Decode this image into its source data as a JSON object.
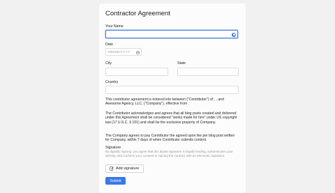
{
  "form": {
    "title": "Contractor Agreement",
    "your_name": {
      "label": "Your Name",
      "value": ""
    },
    "date": {
      "label": "Date",
      "placeholder": "MM/DD/YYYY"
    },
    "city": {
      "label": "City",
      "value": ""
    },
    "state": {
      "label": "State",
      "value": ""
    },
    "country": {
      "label": "Country",
      "value": ""
    },
    "paragraphs": [
      "This contributor agreement is entered into between  (\"Contributor\") of , , and Awesome Agency, LLC. (\"Company\"), effective from .",
      "The Contributor acknowledges and agrees that all blog posts created and delivered under this Agreement shall be considered \"works made for hire\" under US copyright law (17 U.S.C. § 101) and shall be the exclusive property of Company.",
      "The Company agrees to pay Contributor the agreed upon fee per blog post written for Company, within 7 days of when Contributor submits content."
    ],
    "signature": {
      "label": "Signature",
      "help": "By digitally signing, you agree that this digital signature is legally binding, authenticates your identity, and confirms your consent to signing the contract with an electronic signature.",
      "add_label": "Add signature"
    },
    "submit_label": "Submit"
  },
  "colors": {
    "accent": "#3a78e6",
    "focus_border": "#4a7fe0",
    "background": "#f1f1f1",
    "card": "#fdfcfc"
  },
  "icons": {
    "password_manager": "password-manager-icon",
    "calendar": "calendar-icon",
    "signature": "pen-edit-icon"
  }
}
